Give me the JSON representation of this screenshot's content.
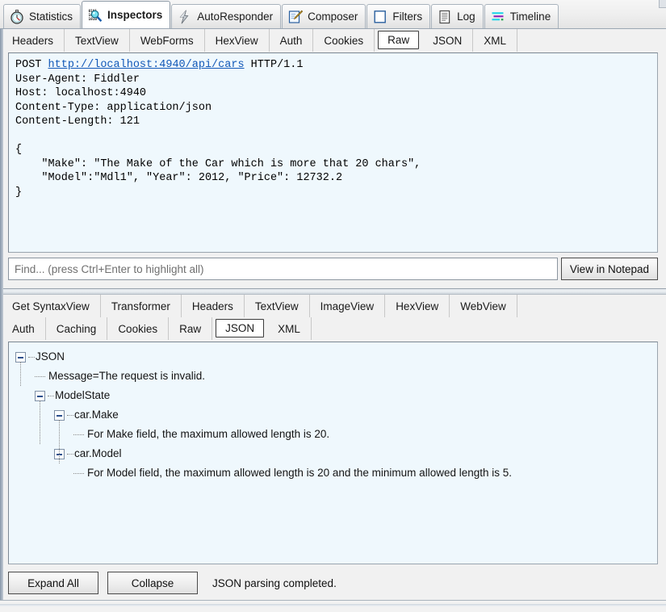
{
  "app": {
    "accent_selected_tab_bg": "#ffffff",
    "content_bg": "#eff8fd",
    "chrome_bg": "#f1f1f1",
    "link_color": "#1258b8"
  },
  "main_tabs": [
    {
      "label": "Statistics",
      "icon": "stopwatch-icon",
      "active": false
    },
    {
      "label": "Inspectors",
      "icon": "magnifier-binary-icon",
      "active": true
    },
    {
      "label": "AutoResponder",
      "icon": "lightning-bolt-icon",
      "active": false
    },
    {
      "label": "Composer",
      "icon": "pencil-notepad-icon",
      "active": false
    },
    {
      "label": "Filters",
      "icon": "blank-square-icon",
      "active": false
    },
    {
      "label": "Log",
      "icon": "document-lines-icon",
      "active": false
    },
    {
      "label": "Timeline",
      "icon": "timeline-bars-icon",
      "active": false
    }
  ],
  "request": {
    "tabs": [
      {
        "label": "Headers",
        "selected": false
      },
      {
        "label": "TextView",
        "selected": false
      },
      {
        "label": "WebForms",
        "selected": false
      },
      {
        "label": "HexView",
        "selected": false
      },
      {
        "label": "Auth",
        "selected": false
      },
      {
        "label": "Cookies",
        "selected": false
      },
      {
        "label": "Raw",
        "selected": true
      },
      {
        "label": "JSON",
        "selected": false
      },
      {
        "label": "XML",
        "selected": false
      }
    ],
    "raw": {
      "method": "POST",
      "url": "http://localhost:4940/api/cars",
      "version": "HTTP/1.1",
      "headers": [
        "User-Agent: Fiddler",
        "Host: localhost:4940",
        "Content-Type: application/json",
        "Content-Length: 121"
      ],
      "body_lines": [
        "{",
        "    \"Make\": \"The Make of the Car which is more that 20 chars\",",
        "    \"Model\":\"Mdl1\", \"Year\": 2012, \"Price\": 12732.2",
        "}"
      ]
    },
    "find": {
      "value": "",
      "placeholder": "Find... (press Ctrl+Enter to highlight all)"
    },
    "view_notepad_label": "View in Notepad"
  },
  "response": {
    "tabs_row1": [
      {
        "label": "Get SyntaxView",
        "selected": false
      },
      {
        "label": "Transformer",
        "selected": false
      },
      {
        "label": "Headers",
        "selected": false
      },
      {
        "label": "TextView",
        "selected": false
      },
      {
        "label": "ImageView",
        "selected": false
      },
      {
        "label": "HexView",
        "selected": false
      },
      {
        "label": "WebView",
        "selected": false
      }
    ],
    "tabs_row2": [
      {
        "label": "Auth",
        "selected": false
      },
      {
        "label": "Caching",
        "selected": false
      },
      {
        "label": "Cookies",
        "selected": false
      },
      {
        "label": "Raw",
        "selected": false
      },
      {
        "label": "JSON",
        "selected": true
      },
      {
        "label": "XML",
        "selected": false
      }
    ],
    "json_tree": [
      {
        "label": "JSON",
        "depth": 0,
        "expandable": true
      },
      {
        "label": "Message=The request is invalid.",
        "depth": 1,
        "expandable": false
      },
      {
        "label": "ModelState",
        "depth": 1,
        "expandable": true
      },
      {
        "label": "car.Make",
        "depth": 2,
        "expandable": true
      },
      {
        "label": "For Make field, the maximum allowed length is 20.",
        "depth": 3,
        "expandable": false
      },
      {
        "label": "car.Model",
        "depth": 2,
        "expandable": true
      },
      {
        "label": "For Model field, the maximum allowed length is 20 and the minimum allowed length is 5.",
        "depth": 3,
        "expandable": false
      }
    ],
    "expand_all_label": "Expand All",
    "collapse_label": "Collapse",
    "parse_status": "JSON parsing completed."
  }
}
